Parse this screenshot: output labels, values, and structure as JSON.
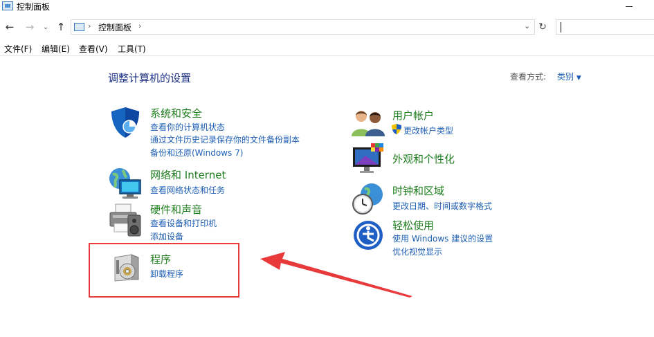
{
  "window": {
    "title": "控制面板"
  },
  "address": {
    "crumb": "控制面板",
    "search_placeholder": ""
  },
  "menu": [
    "文件(F)",
    "编辑(E)",
    "查看(V)",
    "工具(T)"
  ],
  "main": {
    "heading": "调整计算机的设置",
    "view_by_label": "查看方式:",
    "view_by_value": "类别"
  },
  "categories_left": [
    {
      "title": "系统和安全",
      "icon": "shield-icon",
      "links": [
        "查看你的计算机状态",
        "通过文件历史记录保存你的文件备份副本",
        "备份和还原(Windows 7)"
      ]
    },
    {
      "title": "网络和 Internet",
      "icon": "network-globe-icon",
      "links": [
        "查看网络状态和任务"
      ]
    },
    {
      "title": "硬件和声音",
      "icon": "printer-speaker-icon",
      "links": [
        "查看设备和打印机",
        "添加设备"
      ]
    },
    {
      "title": "程序",
      "icon": "program-disc-icon",
      "links": [
        "卸载程序"
      ]
    }
  ],
  "categories_right": [
    {
      "title": "用户帐户",
      "icon": "users-icon",
      "links": [
        "更改帐户类型"
      ]
    },
    {
      "title": "外观和个性化",
      "icon": "monitor-palette-icon",
      "links": []
    },
    {
      "title": "时钟和区域",
      "icon": "clock-globe-icon",
      "links": [
        "更改日期、时间或数字格式"
      ]
    },
    {
      "title": "轻松使用",
      "icon": "ease-of-access-icon",
      "links": [
        "使用 Windows 建议的设置",
        "优化视觉显示"
      ]
    }
  ],
  "colors": {
    "heading": "#1e3287",
    "category_title": "#1e7d1e",
    "link": "#1e5fb4",
    "annotation": "#e83a3a"
  }
}
